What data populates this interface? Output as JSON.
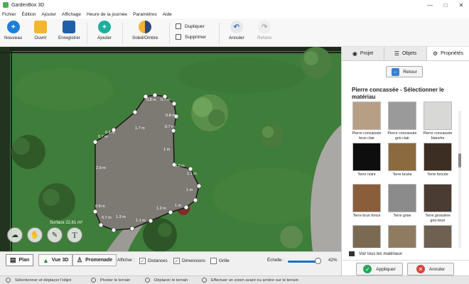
{
  "app": {
    "title": "GardenBox 3D"
  },
  "menu": [
    "Fichier",
    "Édition",
    "Ajouter",
    "Affichage",
    "Heure de la journée",
    "Paramètres",
    "Aide"
  ],
  "toolbar": {
    "new": "Nouveau",
    "open": "Ouvrir",
    "save": "Enregistrer",
    "add": "Ajouter",
    "sun": "Soleil/Ombre",
    "duplicate": "Dupliquer",
    "delete": "Supprimer",
    "undo": "Annuler",
    "redo": "Refaire"
  },
  "canvas": {
    "surface": "Surface 22.61 m²",
    "measurements": [
      "0.8 m",
      "0.7 m",
      "1.7 m",
      "0.8 m",
      "0.7 m",
      "1 m",
      "0.9 m",
      "1.1 m",
      "1 m",
      "1.2 m",
      "1 m",
      "1.1 m",
      "1.3 m",
      "0.7 m",
      "0.8 m",
      "2.9 m",
      "0.7 m",
      "0.8 m"
    ]
  },
  "tabs": {
    "project": "Projet",
    "objects": "Objets",
    "properties": "Propriétés"
  },
  "panel": {
    "back": "Retour",
    "title": "Pierre concassée - Sélectionner le matériau",
    "materials": [
      {
        "name": "Pierre concassée brun clair",
        "color": "#b79f86"
      },
      {
        "name": "Pierre concassée gris clair",
        "color": "#9a9a9a"
      },
      {
        "name": "Pierre concassée blanche",
        "color": "#d8d8d6"
      },
      {
        "name": "Terre noire",
        "color": "#0e0e0e"
      },
      {
        "name": "Terre brune",
        "color": "#8a6a3e"
      },
      {
        "name": "Terre foncée",
        "color": "#3d2e23"
      },
      {
        "name": "Terre brun foncé",
        "color": "#8a5e3a"
      },
      {
        "name": "Terre grise",
        "color": "#8b8b8b"
      },
      {
        "name": "Terre grossière gris-brun",
        "color": "#4a3c33"
      },
      {
        "name": "",
        "color": "#7b6a52"
      },
      {
        "name": "",
        "color": "#8f7c60"
      },
      {
        "name": "",
        "color": "#6f6152"
      }
    ],
    "see_all": "Voir tous les matériaux",
    "apply": "Appliquer",
    "cancel": "Annuler"
  },
  "views": {
    "plan": "Plan",
    "view3d": "Vue 3D",
    "walk": "Promenade"
  },
  "display": {
    "show": "Afficher :",
    "distances": "Distances",
    "dimensions": "Dimensions",
    "grid": "Grille",
    "scale": "Échelle :",
    "scale_value": "42%",
    "scale_fraction": 0.42
  },
  "status": {
    "select": "Sélectionner et déplacer l'objet",
    "rotate": "Pivoter le terrain",
    "move": "Déplacer le terrain",
    "zoom": "Effectuer un zoom avant ou arrière sur le terrain"
  },
  "colors": {
    "accent": "#1a6fc9",
    "grass": "#3f7d3a",
    "gravel": "#7d7a74",
    "ok": "#22a85a",
    "cancel": "#d9443b"
  }
}
